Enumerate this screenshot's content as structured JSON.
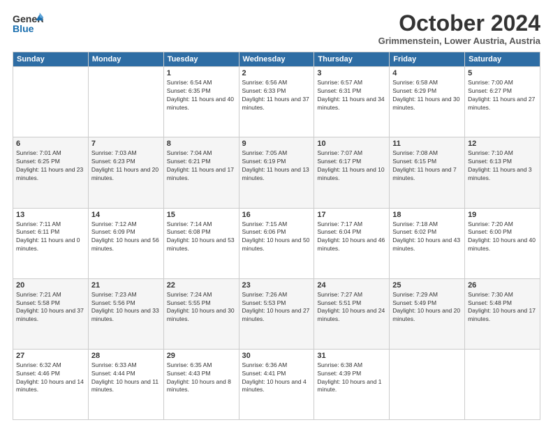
{
  "header": {
    "logo_general": "General",
    "logo_blue": "Blue",
    "title": "October 2024",
    "location": "Grimmenstein, Lower Austria, Austria"
  },
  "days_of_week": [
    "Sunday",
    "Monday",
    "Tuesday",
    "Wednesday",
    "Thursday",
    "Friday",
    "Saturday"
  ],
  "weeks": [
    [
      {
        "day": "",
        "info": ""
      },
      {
        "day": "",
        "info": ""
      },
      {
        "day": "1",
        "info": "Sunrise: 6:54 AM\nSunset: 6:35 PM\nDaylight: 11 hours and 40 minutes."
      },
      {
        "day": "2",
        "info": "Sunrise: 6:56 AM\nSunset: 6:33 PM\nDaylight: 11 hours and 37 minutes."
      },
      {
        "day": "3",
        "info": "Sunrise: 6:57 AM\nSunset: 6:31 PM\nDaylight: 11 hours and 34 minutes."
      },
      {
        "day": "4",
        "info": "Sunrise: 6:58 AM\nSunset: 6:29 PM\nDaylight: 11 hours and 30 minutes."
      },
      {
        "day": "5",
        "info": "Sunrise: 7:00 AM\nSunset: 6:27 PM\nDaylight: 11 hours and 27 minutes."
      }
    ],
    [
      {
        "day": "6",
        "info": "Sunrise: 7:01 AM\nSunset: 6:25 PM\nDaylight: 11 hours and 23 minutes."
      },
      {
        "day": "7",
        "info": "Sunrise: 7:03 AM\nSunset: 6:23 PM\nDaylight: 11 hours and 20 minutes."
      },
      {
        "day": "8",
        "info": "Sunrise: 7:04 AM\nSunset: 6:21 PM\nDaylight: 11 hours and 17 minutes."
      },
      {
        "day": "9",
        "info": "Sunrise: 7:05 AM\nSunset: 6:19 PM\nDaylight: 11 hours and 13 minutes."
      },
      {
        "day": "10",
        "info": "Sunrise: 7:07 AM\nSunset: 6:17 PM\nDaylight: 11 hours and 10 minutes."
      },
      {
        "day": "11",
        "info": "Sunrise: 7:08 AM\nSunset: 6:15 PM\nDaylight: 11 hours and 7 minutes."
      },
      {
        "day": "12",
        "info": "Sunrise: 7:10 AM\nSunset: 6:13 PM\nDaylight: 11 hours and 3 minutes."
      }
    ],
    [
      {
        "day": "13",
        "info": "Sunrise: 7:11 AM\nSunset: 6:11 PM\nDaylight: 11 hours and 0 minutes."
      },
      {
        "day": "14",
        "info": "Sunrise: 7:12 AM\nSunset: 6:09 PM\nDaylight: 10 hours and 56 minutes."
      },
      {
        "day": "15",
        "info": "Sunrise: 7:14 AM\nSunset: 6:08 PM\nDaylight: 10 hours and 53 minutes."
      },
      {
        "day": "16",
        "info": "Sunrise: 7:15 AM\nSunset: 6:06 PM\nDaylight: 10 hours and 50 minutes."
      },
      {
        "day": "17",
        "info": "Sunrise: 7:17 AM\nSunset: 6:04 PM\nDaylight: 10 hours and 46 minutes."
      },
      {
        "day": "18",
        "info": "Sunrise: 7:18 AM\nSunset: 6:02 PM\nDaylight: 10 hours and 43 minutes."
      },
      {
        "day": "19",
        "info": "Sunrise: 7:20 AM\nSunset: 6:00 PM\nDaylight: 10 hours and 40 minutes."
      }
    ],
    [
      {
        "day": "20",
        "info": "Sunrise: 7:21 AM\nSunset: 5:58 PM\nDaylight: 10 hours and 37 minutes."
      },
      {
        "day": "21",
        "info": "Sunrise: 7:23 AM\nSunset: 5:56 PM\nDaylight: 10 hours and 33 minutes."
      },
      {
        "day": "22",
        "info": "Sunrise: 7:24 AM\nSunset: 5:55 PM\nDaylight: 10 hours and 30 minutes."
      },
      {
        "day": "23",
        "info": "Sunrise: 7:26 AM\nSunset: 5:53 PM\nDaylight: 10 hours and 27 minutes."
      },
      {
        "day": "24",
        "info": "Sunrise: 7:27 AM\nSunset: 5:51 PM\nDaylight: 10 hours and 24 minutes."
      },
      {
        "day": "25",
        "info": "Sunrise: 7:29 AM\nSunset: 5:49 PM\nDaylight: 10 hours and 20 minutes."
      },
      {
        "day": "26",
        "info": "Sunrise: 7:30 AM\nSunset: 5:48 PM\nDaylight: 10 hours and 17 minutes."
      }
    ],
    [
      {
        "day": "27",
        "info": "Sunrise: 6:32 AM\nSunset: 4:46 PM\nDaylight: 10 hours and 14 minutes."
      },
      {
        "day": "28",
        "info": "Sunrise: 6:33 AM\nSunset: 4:44 PM\nDaylight: 10 hours and 11 minutes."
      },
      {
        "day": "29",
        "info": "Sunrise: 6:35 AM\nSunset: 4:43 PM\nDaylight: 10 hours and 8 minutes."
      },
      {
        "day": "30",
        "info": "Sunrise: 6:36 AM\nSunset: 4:41 PM\nDaylight: 10 hours and 4 minutes."
      },
      {
        "day": "31",
        "info": "Sunrise: 6:38 AM\nSunset: 4:39 PM\nDaylight: 10 hours and 1 minute."
      },
      {
        "day": "",
        "info": ""
      },
      {
        "day": "",
        "info": ""
      }
    ]
  ]
}
